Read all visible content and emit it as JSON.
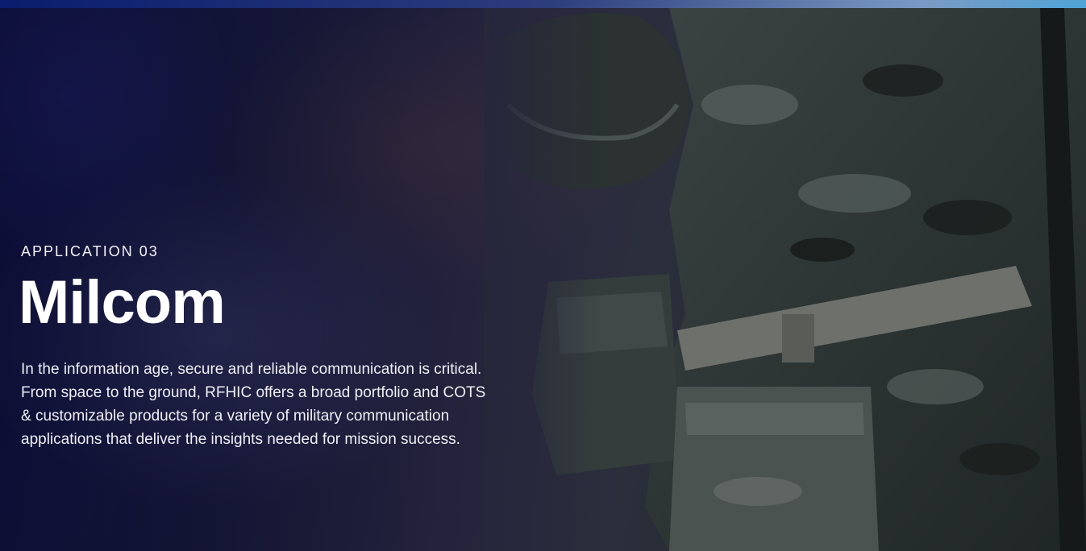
{
  "hero": {
    "eyebrow": "APPLICATION 03",
    "title": "Milcom",
    "description": "In the information age, secure and reliable communication is critical. From space to the ground, RFHIC offers a broad portfolio and COTS & customizable products for a variety of military communication applications that deliver the insights needed for mission success."
  },
  "colors": {
    "accent_strip": "#2c3c7c",
    "text": "#ffffff"
  }
}
